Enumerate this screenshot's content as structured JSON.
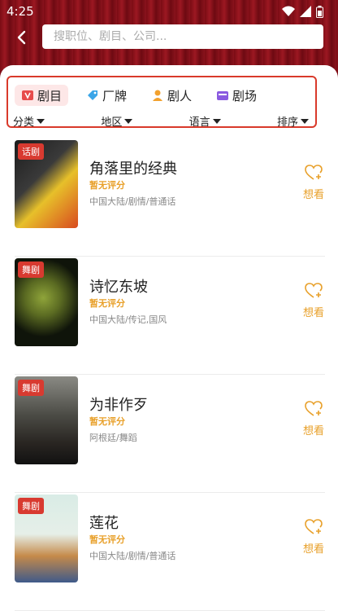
{
  "status": {
    "time": "4:25"
  },
  "search": {
    "placeholder": "搜职位、剧目、公司..."
  },
  "categories": [
    {
      "label": "剧目",
      "icon": "play-script-icon",
      "active": true
    },
    {
      "label": "厂牌",
      "icon": "tag-icon",
      "active": false
    },
    {
      "label": "剧人",
      "icon": "person-icon",
      "active": false
    },
    {
      "label": "剧场",
      "icon": "theater-icon",
      "active": false
    }
  ],
  "filters": [
    {
      "label": "分类"
    },
    {
      "label": "地区"
    },
    {
      "label": "语言"
    },
    {
      "label": "排序"
    }
  ],
  "items": [
    {
      "badge": "话剧",
      "title": "角落里的经典",
      "rating": "暂无评分",
      "meta": "中国大陆/剧情/普通话",
      "want": "想看"
    },
    {
      "badge": "舞剧",
      "title": "诗忆东坡",
      "rating": "暂无评分",
      "meta": "中国大陆/传记,国风",
      "want": "想看"
    },
    {
      "badge": "舞剧",
      "title": "为非作歹",
      "rating": "暂无评分",
      "meta": "阿根廷/舞蹈",
      "want": "想看"
    },
    {
      "badge": "舞剧",
      "title": "莲花",
      "rating": "暂无评分",
      "meta": "中国大陆/剧情/普通话",
      "want": "想看"
    }
  ],
  "colors": {
    "accent": "#e8a02a",
    "brand_red": "#d83a30",
    "header_bg": "#8a131d"
  }
}
